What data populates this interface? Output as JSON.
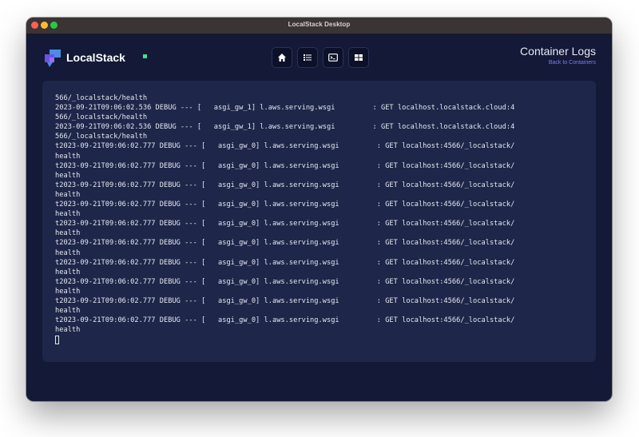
{
  "window": {
    "title": "LocalStack Desktop"
  },
  "app": {
    "name": "LocalStack"
  },
  "nav": {
    "items": [
      "home-icon",
      "list-icon",
      "terminal-icon",
      "grid-icon"
    ]
  },
  "header": {
    "title": "Container Logs",
    "back_link": "Back to Containers"
  },
  "logs": {
    "lines": [
      "566/_localstack/health",
      "2023-09-21T09:06:02.536 DEBUG --- [   asgi_gw_1] l.aws.serving.wsgi         : GET localhost.localstack.cloud:4",
      "566/_localstack/health",
      "2023-09-21T09:06:02.536 DEBUG --- [   asgi_gw_1] l.aws.serving.wsgi         : GET localhost.localstack.cloud:4",
      "566/_localstack/health",
      "t2023-09-21T09:06:02.777 DEBUG --- [   asgi_gw_0] l.aws.serving.wsgi         : GET localhost:4566/_localstack/",
      "health",
      "t2023-09-21T09:06:02.777 DEBUG --- [   asgi_gw_0] l.aws.serving.wsgi         : GET localhost:4566/_localstack/",
      "health",
      "t2023-09-21T09:06:02.777 DEBUG --- [   asgi_gw_0] l.aws.serving.wsgi         : GET localhost:4566/_localstack/",
      "health",
      "t2023-09-21T09:06:02.777 DEBUG --- [   asgi_gw_0] l.aws.serving.wsgi         : GET localhost:4566/_localstack/",
      "health",
      "t2023-09-21T09:06:02.777 DEBUG --- [   asgi_gw_0] l.aws.serving.wsgi         : GET localhost:4566/_localstack/",
      "health",
      "t2023-09-21T09:06:02.777 DEBUG --- [   asgi_gw_0] l.aws.serving.wsgi         : GET localhost:4566/_localstack/",
      "health",
      "t2023-09-21T09:06:02.777 DEBUG --- [   asgi_gw_0] l.aws.serving.wsgi         : GET localhost:4566/_localstack/",
      "health",
      "t2023-09-21T09:06:02.777 DEBUG --- [   asgi_gw_0] l.aws.serving.wsgi         : GET localhost:4566/_localstack/",
      "health",
      "t2023-09-21T09:06:02.777 DEBUG --- [   asgi_gw_0] l.aws.serving.wsgi         : GET localhost:4566/_localstack/",
      "health",
      "t2023-09-21T09:06:02.777 DEBUG --- [   asgi_gw_0] l.aws.serving.wsgi         : GET localhost:4566/_localstack/",
      "health"
    ]
  },
  "colors": {
    "window_bg": "#131937",
    "panel_bg": "#1e2749",
    "accent": "#7b7ef0",
    "logo_green": "#3ee18a"
  }
}
